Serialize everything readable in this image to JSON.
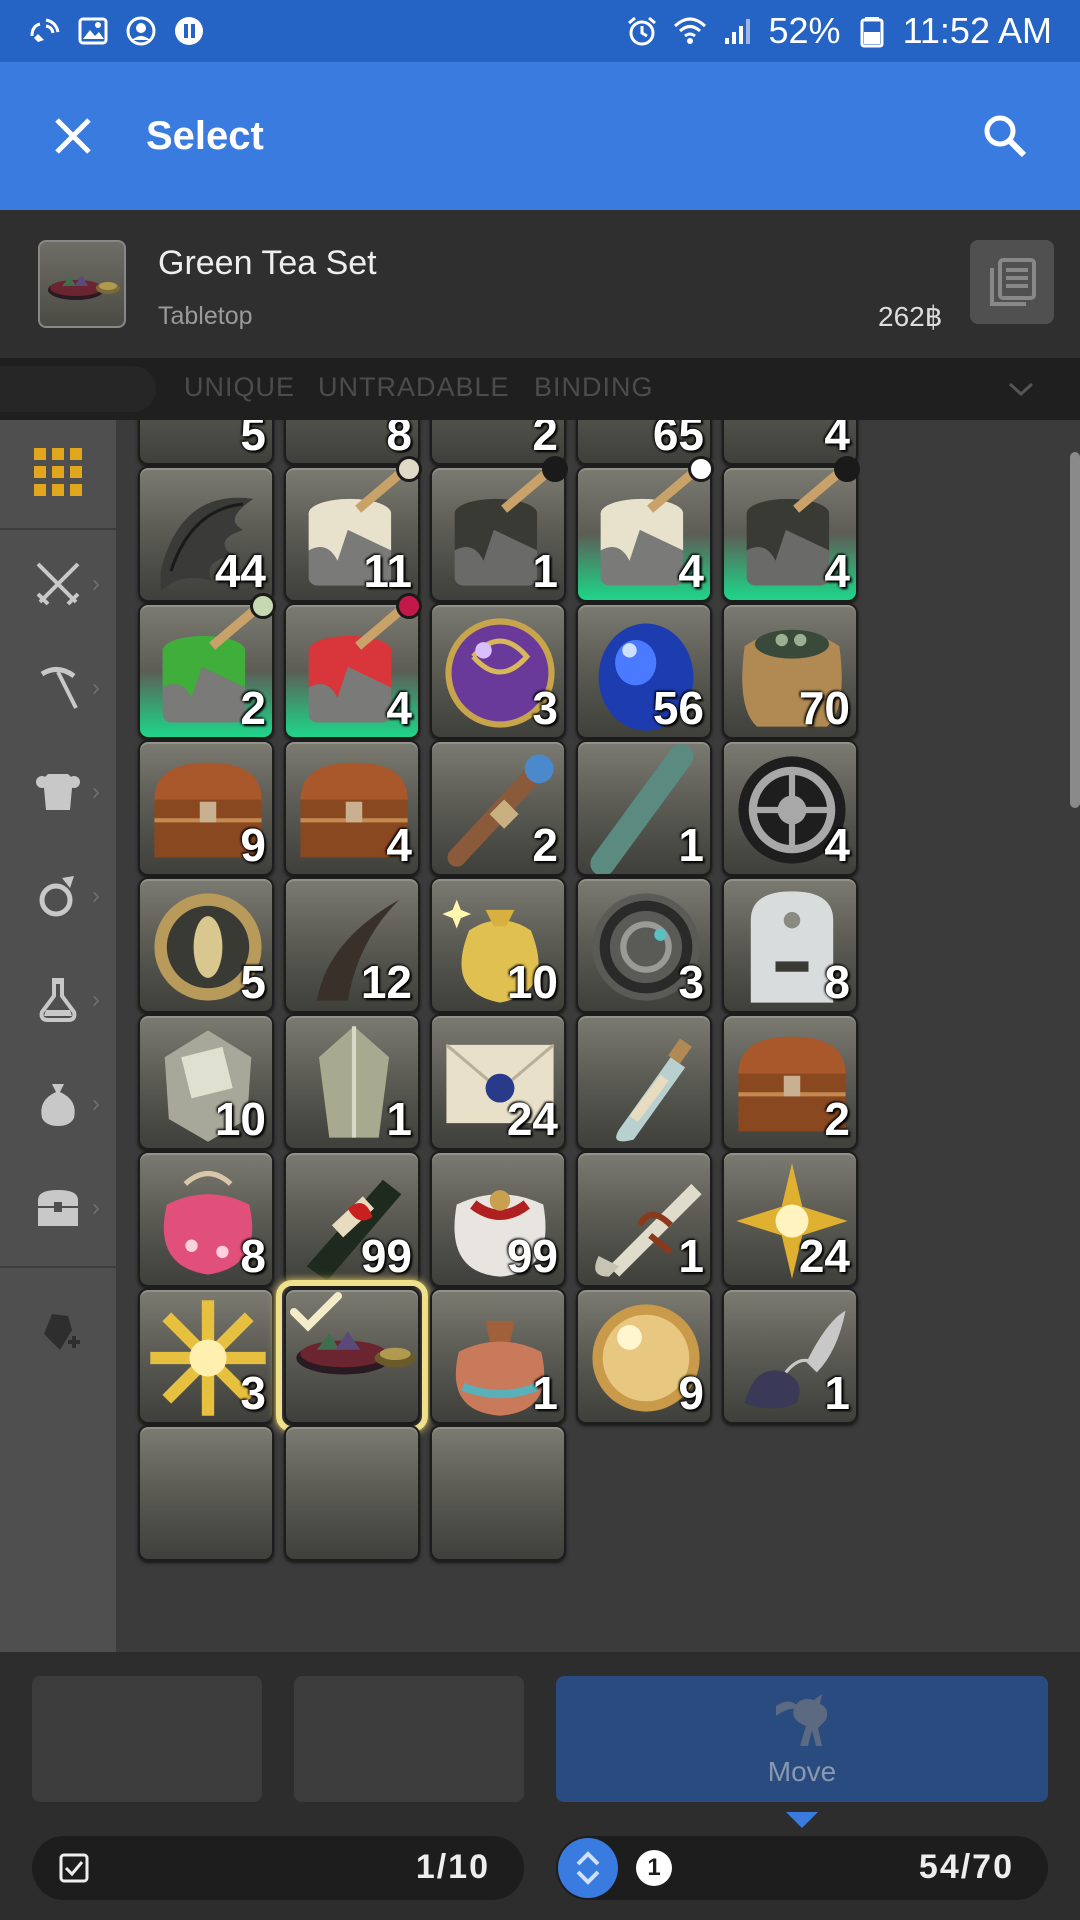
{
  "status_bar": {
    "battery": "52%",
    "time": "11:52 AM"
  },
  "app_bar": {
    "title": "Select"
  },
  "item": {
    "name": "Green Tea Set",
    "category": "Tabletop",
    "price": "262฿"
  },
  "filters": [
    "UNIQUE",
    "UNTRADABLE",
    "BINDING"
  ],
  "grid": {
    "rows": [
      [
        {
          "art": "wing",
          "qty": "44"
        },
        {
          "art": "paint-white",
          "qty": "11",
          "dot": "#e0d9c8"
        },
        {
          "art": "paint-black",
          "qty": "1",
          "dot": "#1a1a1a"
        },
        {
          "art": "paint-white",
          "qty": "4",
          "dot": "#ffffff",
          "hq": true
        },
        {
          "art": "paint-black",
          "qty": "4",
          "dot": "#1a1a1a",
          "hq": true
        }
      ],
      [
        {
          "art": "paint-green",
          "qty": "2",
          "dot": "#c6d8b0",
          "hq": true
        },
        {
          "art": "paint-red",
          "qty": "4",
          "dot": "#c2184a",
          "hq": true
        },
        {
          "art": "orb-purple",
          "qty": "3"
        },
        {
          "art": "gem-blue",
          "qty": "56"
        },
        {
          "art": "sack",
          "qty": "70"
        }
      ],
      [
        {
          "art": "chest",
          "qty": "9"
        },
        {
          "art": "chest",
          "qty": "4"
        },
        {
          "art": "scroll-rod",
          "qty": "2"
        },
        {
          "art": "stick",
          "qty": "1"
        },
        {
          "art": "gear",
          "qty": "4"
        }
      ],
      [
        {
          "art": "coin",
          "qty": "5"
        },
        {
          "art": "claw",
          "qty": "12"
        },
        {
          "art": "gold-bag",
          "qty": "10"
        },
        {
          "art": "gear-ornate",
          "qty": "3"
        },
        {
          "art": "tablet",
          "qty": "8"
        }
      ],
      [
        {
          "art": "rock",
          "qty": "10"
        },
        {
          "art": "crystal",
          "qty": "1"
        },
        {
          "art": "letter",
          "qty": "24"
        },
        {
          "art": "bottle",
          "qty": ""
        },
        {
          "art": "chest",
          "qty": "2"
        }
      ],
      [
        {
          "art": "pouch-pink",
          "qty": "8"
        },
        {
          "art": "champagne",
          "qty": "99"
        },
        {
          "art": "gift-bag",
          "qty": "99"
        },
        {
          "art": "scroll",
          "qty": "1"
        },
        {
          "art": "star-ornament",
          "qty": "24"
        }
      ],
      [
        {
          "art": "snowflake",
          "qty": "3"
        },
        {
          "art": "tea-set",
          "qty": "",
          "selected": true
        },
        {
          "art": "pouch-brown",
          "qty": "1"
        },
        {
          "art": "orb-gold",
          "qty": "9"
        },
        {
          "art": "fish-lure",
          "qty": "1"
        }
      ]
    ],
    "partial_top": [
      "5",
      "8",
      "2",
      "65",
      "4"
    ]
  },
  "bottom": {
    "move_label": "Move",
    "selected_count": "1/10",
    "stack_index": "1",
    "capacity": "54/70"
  },
  "colors": {
    "accent": "#3a7be0",
    "status_bar": "#2563c4",
    "hq_green": "#1fd58a",
    "select_gold": "#f0e08a"
  }
}
